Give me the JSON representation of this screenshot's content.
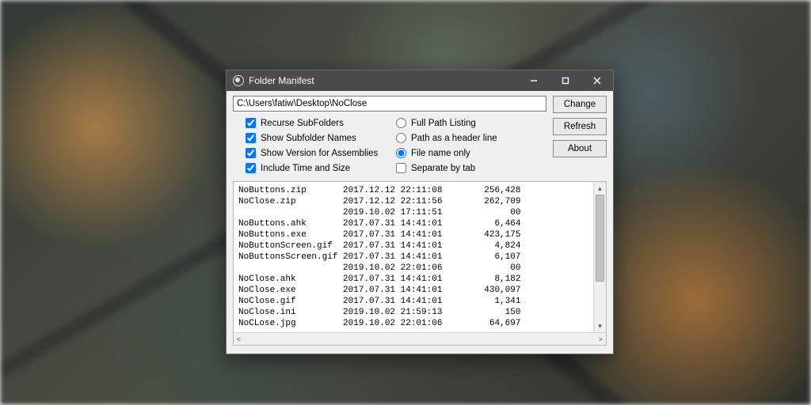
{
  "window": {
    "title": "Folder Manifest"
  },
  "path": {
    "value": "C:\\Users\\fatiw\\Desktop\\NoClose"
  },
  "buttons": {
    "change": "Change",
    "refresh": "Refresh",
    "about": "About"
  },
  "options_left": [
    {
      "label": "Recurse SubFolders",
      "checked": true
    },
    {
      "label": "Show Subfolder Names",
      "checked": true
    },
    {
      "label": "Show Version for Assemblies",
      "checked": true
    },
    {
      "label": "Include Time and Size",
      "checked": true
    }
  ],
  "options_right": [
    {
      "type": "radio",
      "label": "Full Path Listing",
      "checked": false
    },
    {
      "type": "radio",
      "label": "Path as a header line",
      "checked": false
    },
    {
      "type": "radio",
      "label": "File name only",
      "checked": true
    },
    {
      "type": "checkbox",
      "label": "Separate by tab",
      "checked": false
    }
  ],
  "listing": [
    {
      "name": "NoButtons.zip",
      "date": "2017.12.12",
      "time": "22:11:08",
      "size": "256,428"
    },
    {
      "name": "NoClose.zip",
      "date": "2017.12.12",
      "time": "22:11:56",
      "size": "262,709"
    },
    {
      "name": "",
      "date": "2019.10.02",
      "time": "17:11:51",
      "size": "00"
    },
    {
      "name": "NoButtons.ahk",
      "date": "2017.07.31",
      "time": "14:41:01",
      "size": "6,464"
    },
    {
      "name": "NoButtons.exe",
      "date": "2017.07.31",
      "time": "14:41:01",
      "size": "423,175"
    },
    {
      "name": "NoButtonScreen.gif",
      "date": "2017.07.31",
      "time": "14:41:01",
      "size": "4,824"
    },
    {
      "name": "NoButtonsScreen.gif",
      "date": "2017.07.31",
      "time": "14:41:01",
      "size": "6,107"
    },
    {
      "name": "",
      "date": "2019.10.02",
      "time": "22:01:06",
      "size": "00"
    },
    {
      "name": "NoClose.ahk",
      "date": "2017.07.31",
      "time": "14:41:01",
      "size": "8,182"
    },
    {
      "name": "NoClose.exe",
      "date": "2017.07.31",
      "time": "14:41:01",
      "size": "430,097"
    },
    {
      "name": "NoClose.gif",
      "date": "2017.07.31",
      "time": "14:41:01",
      "size": "1,341"
    },
    {
      "name": "NoClose.ini",
      "date": "2019.10.02",
      "time": "21:59:13",
      "size": "150"
    },
    {
      "name": "NoCLose.jpg",
      "date": "2019.10.02",
      "time": "22:01:06",
      "size": "64,697"
    }
  ]
}
